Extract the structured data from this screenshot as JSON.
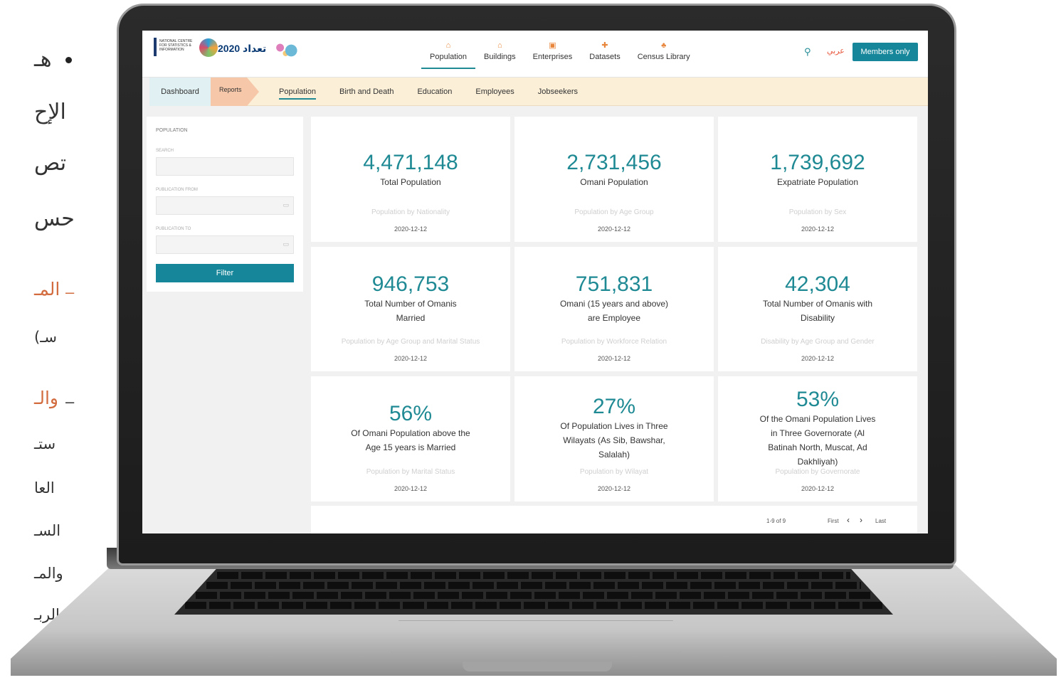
{
  "slide": {
    "lines": [
      "هـ",
      "الإح",
      "تص",
      "حس"
    ],
    "sub1": "المـ",
    "sub1b": "(سـ",
    "sub2": "والـ",
    "sub2_lines": [
      "ستـ",
      "العا",
      "السـ",
      "والمـ",
      "الربـ"
    ]
  },
  "header": {
    "logo_org": "NATIONAL CENTRE FOR STATISTICS & INFORMATION",
    "logo_census": "2020 تعداد",
    "nav": [
      {
        "label": "Population",
        "icon": "people-icon",
        "active": true
      },
      {
        "label": "Buildings",
        "icon": "building-icon",
        "active": false
      },
      {
        "label": "Enterprises",
        "icon": "enterprise-icon",
        "active": false
      },
      {
        "label": "Datasets",
        "icon": "dataset-icon",
        "active": false
      },
      {
        "label": "Census Library",
        "icon": "library-icon",
        "active": false
      }
    ],
    "language": "عربي",
    "members_button": "Members only"
  },
  "subnav": {
    "dashboard": "Dashboard",
    "reports": "Reports",
    "tabs": [
      "Population",
      "Birth and Death",
      "Education",
      "Employees",
      "Jobseekers"
    ],
    "active_tab": "Population"
  },
  "filter": {
    "title": "POPULATION",
    "search_label": "SEARCH",
    "search_value": "",
    "from_label": "PUBLICATION FROM",
    "from_value": "",
    "to_label": "PUBLICATION TO",
    "to_value": "",
    "button": "Filter"
  },
  "cards": [
    {
      "value": "4,471,148",
      "label": "Total Population",
      "link": "Population by Nationality",
      "date": "2020-12-12"
    },
    {
      "value": "2,731,456",
      "label": "Omani Population",
      "link": "Population by Age Group",
      "date": "2020-12-12"
    },
    {
      "value": "1,739,692",
      "label": "Expatriate Population",
      "link": "Population by Sex",
      "date": "2020-12-12"
    },
    {
      "value": "946,753",
      "label": "Total Number of Omanis Married",
      "link": "Population by Age Group and Marital Status",
      "date": "2020-12-12"
    },
    {
      "value": "751,831",
      "label": "Omani (15 years and above) are Employee",
      "link": "Population by Workforce Relation",
      "date": "2020-12-12"
    },
    {
      "value": "42,304",
      "label": "Total Number of Omanis with Disability",
      "link": "Disability by Age Group and Gender",
      "date": "2020-12-12"
    },
    {
      "value": "56%",
      "label": "Of Omani Population above the Age 15 years is Married",
      "link": "Population by Marital Status",
      "date": "2020-12-12"
    },
    {
      "value": "27%",
      "label": "Of Population Lives in Three Wilayats (As Sib, Bawshar, Salalah)",
      "link": "Population by Wilayat",
      "date": "2020-12-12"
    },
    {
      "value": "53%",
      "label": "Of the Omani Population Lives in Three Governorate (Al Batinah North, Muscat, Ad Dakhliyah)",
      "link": "Population by Governorate",
      "date": "2020-12-12"
    }
  ],
  "pagination": {
    "range": "1-9 of 9",
    "first": "First",
    "prev": "‹",
    "next": "›",
    "last": "Last"
  },
  "colors": {
    "accent": "#1f8a94",
    "subbar": "#fbefd8",
    "reports_tab": "#f6c7a8",
    "dashboard_tab": "#e1f0f2",
    "language": "#e8573c"
  }
}
